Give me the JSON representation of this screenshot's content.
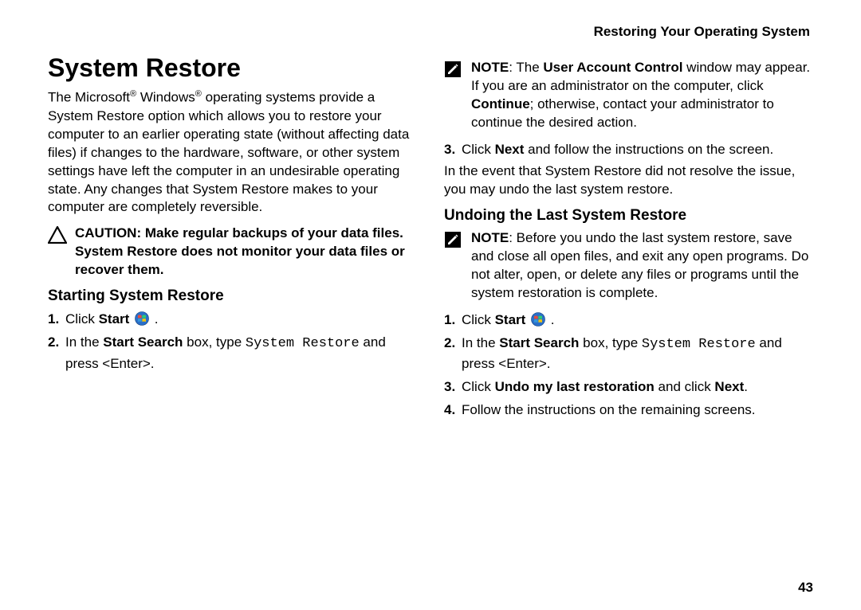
{
  "header": "Restoring Your Operating System",
  "title": "System Restore",
  "intro_pre": "The Microsoft",
  "intro_mid": " Windows",
  "intro_post": " operating systems provide a System Restore option which allows you to restore your computer to an earlier operating state (without affecting data files) if changes to the hardware, software, or other system settings have left the computer in an undesirable operating state. Any changes that System Restore makes to your computer are completely reversible.",
  "caution_label": "CAUTION: ",
  "caution_text": "Make regular backups of your data files. System Restore does not monitor your data files or recover them.",
  "starting_heading": "Starting System Restore",
  "step_click": "Click ",
  "step_start_label": "Start",
  "step_period": " .",
  "step2_pre": "In the ",
  "step2_bold": "Start Search",
  "step2_mid": " box, type ",
  "step2_code": "System Restore",
  "step2_post": " and press <Enter>.",
  "note_label": "NOTE",
  "note1_pre": ": The ",
  "note1_bold": "User Account Control",
  "note1_mid": " window may appear. If you are an administrator on the computer, click ",
  "note1_bold2": "Continue",
  "note1_post": "; otherwise, contact your administrator to continue the desired action.",
  "step3_pre": "Click ",
  "step3_bold": "Next",
  "step3_post": " and follow the instructions on the screen.",
  "bridge": "In the event that System Restore did not resolve the issue, you may undo the last system restore.",
  "undo_heading": "Undoing the Last System Restore",
  "note2_text": ": Before you undo the last system restore, save and close all open files, and exit any open programs. Do not alter, open, or delete any files or programs until the system restoration is complete.",
  "undo_step3_pre": "Click ",
  "undo_step3_bold": "Undo my last restoration",
  "undo_step3_mid": " and click ",
  "undo_step3_bold2": "Next",
  "undo_step3_post": ".",
  "undo_step4": "Follow the instructions on the remaining screens.",
  "page_number": "43"
}
